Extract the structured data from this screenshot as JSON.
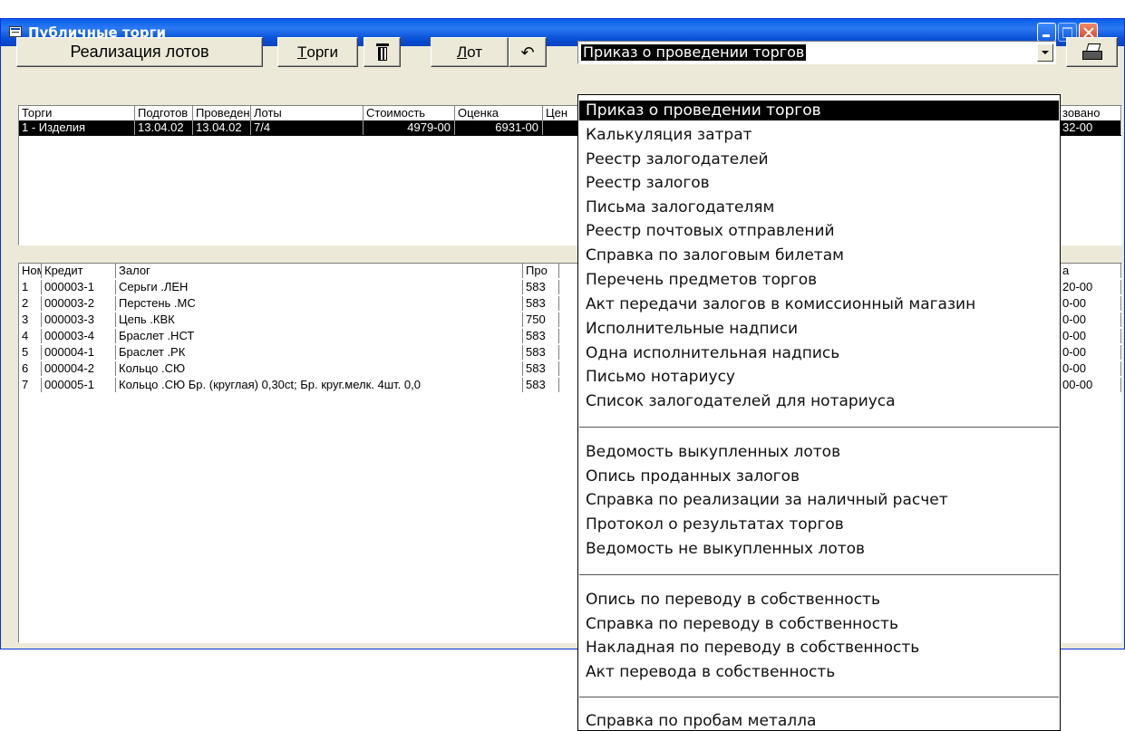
{
  "window": {
    "title": "Публичные торги"
  },
  "toolbar": {
    "realize_label": "Реализация лотов",
    "torgi_label": "Торги",
    "torgi_accel": "Т",
    "torgi_rest": "орги",
    "delete_icon": "trash-icon",
    "lot_label": "Лот",
    "lot_accel": "Л",
    "lot_rest": "от",
    "undo_icon": "undo-icon",
    "report_selected": "Приказ о проведении торгов",
    "print_icon": "printer-icon"
  },
  "auctions": {
    "headers": [
      "Торги",
      "Подготов",
      "Проведен",
      "Лоты",
      "Стоимость",
      "Оценка",
      "Цен",
      "зовано"
    ],
    "selected_row": [
      "1 - Изделия",
      "13.04.02",
      "13.04.02",
      "7/4",
      "4979-00",
      "6931-00",
      "",
      "32-00"
    ]
  },
  "lots": {
    "headers": [
      "Ном",
      "Кредит",
      "Залог",
      "Про",
      "а"
    ],
    "rows": [
      [
        "1",
        "000003-1",
        "Серьги .ЛЕН",
        "583",
        "20-00"
      ],
      [
        "2",
        "000003-2",
        "Перстень .МС",
        "583",
        "0-00"
      ],
      [
        "3",
        "000003-3",
        "Цепь .КВК",
        "750",
        "0-00"
      ],
      [
        "4",
        "000003-4",
        "Браслет .НСТ",
        "583",
        "0-00"
      ],
      [
        "5",
        "000004-1",
        "Браслет .РК",
        "583",
        "0-00"
      ],
      [
        "6",
        "000004-2",
        "Кольцо .СЮ",
        "583",
        "0-00"
      ],
      [
        "7",
        "000005-1",
        "Кольцо .СЮ Бр. (круглая) 0,30ct; Бр. круг.мелк. 4шт. 0,0",
        "583",
        "00-00"
      ]
    ]
  },
  "report_menu": {
    "group1": [
      "Приказ о проведении торгов",
      "Калькуляция затрат",
      "Реестр залогодателей",
      "Реестр залогов",
      "Письма залогодателям",
      "Реестр почтовых отправлений",
      "Справка по залоговым билетам",
      "Перечень предметов торгов",
      "Акт передачи залогов в комиссионный магазин",
      "Исполнительные надписи",
      "Одна исполнительная надпись",
      "Письмо нотариусу",
      "Список залогодателей для нотариуса"
    ],
    "group2": [
      "Ведомость выкупленных лотов",
      "Опись проданных залогов",
      "Справка по реализации за наличный расчет",
      "Протокол о результатах торгов",
      "Ведомость не выкупленных лотов"
    ],
    "group3": [
      "Опись по переводу в собственность",
      "Справка по переводу в собственность",
      "Накладная по переводу в собственность",
      "Акт перевода в собственность"
    ],
    "group4": [
      "Справка по пробам металла"
    ]
  }
}
